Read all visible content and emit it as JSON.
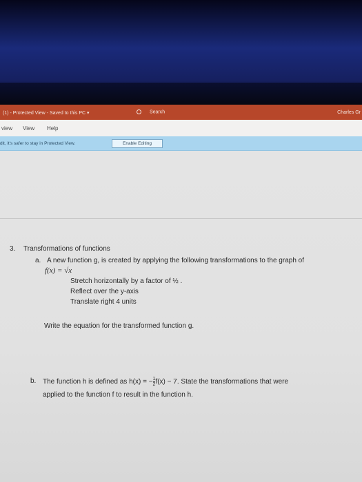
{
  "title_bar": {
    "doc_title": "(1)  -  Protected View  -  Saved to this PC  ▾",
    "search_label": "Search",
    "user_name": "Charles Gr"
  },
  "ribbon": {
    "tabs": [
      "view",
      "View",
      "Help"
    ]
  },
  "protected_view_bar": {
    "message": "dit, it's safer to stay in Protected View.",
    "enable_button": "Enable Editing"
  },
  "document": {
    "q3_number": "3.",
    "q3_title": "Transformations of functions",
    "a_label": "a.",
    "a_text": "A new function g, is created by applying the following transformations to the graph of",
    "a_function": "f(x) = √x",
    "step1": "Stretch horizontally by a factor of ½ .",
    "step2": "Reflect over the y-axis",
    "step3": "Translate right 4 units",
    "write_prompt": "Write the equation for the transformed function g.",
    "b_label": "b.",
    "b_text_1": "The function h is defined as h(x) = −",
    "b_frac_num": "1",
    "b_frac_den": "2",
    "b_text_2": "f(x) − 7. State the transformations that were",
    "b_text_3": "applied to the function f to result in the function h."
  }
}
